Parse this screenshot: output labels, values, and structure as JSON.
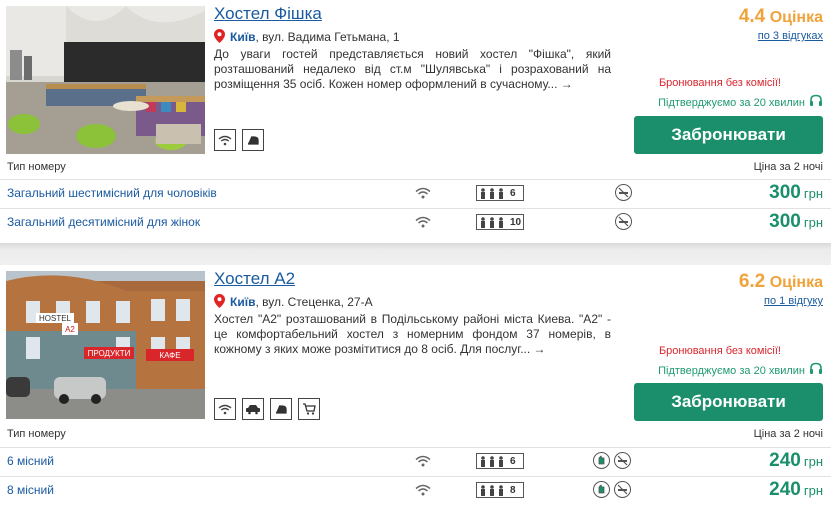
{
  "hostels": [
    {
      "name": "Хостел Фішка",
      "city": "Київ",
      "street": ", вул. Вадима Гетьмана, 1",
      "description": "До уваги гостей представляється новий хостел \"Фішка\", який розташований недалеко від ст.м \"Шулявська\" і розрахований на розміщення 35 осіб. Кожен номер оформлений в сучасному... →",
      "rating": "4.4",
      "rating_label": "Оцінка",
      "reviews": "по 3 відгуках",
      "no_commission": "Бронювання без комісії!",
      "confirm": "Підтверджуємо за 20 хвилин",
      "book_label": "Забронювати",
      "amenities": [
        "wifi-icon",
        "iron-icon"
      ],
      "room_type_header": "Тип номеру",
      "price_header": "Ціна за 2 ночі",
      "rooms": [
        {
          "name": "Загальний шестимісний для чоловіків",
          "capacity": "6",
          "price": "300",
          "currency": "грн"
        },
        {
          "name": "Загальний десятимісний для жінок",
          "capacity": "10",
          "price": "300",
          "currency": "грн"
        }
      ]
    },
    {
      "name": "Хостел А2",
      "city": "Київ",
      "street": ", вул. Стеценка, 27-А",
      "description": "Хостел \"А2\" розташований в Подільському районі міста Киева. \"А2\" - це комфортабельний хостел з номерним фондом 37 номерів, в кожному з яких може розмітитися до 8 осіб. Для послуг... →",
      "rating": "6.2",
      "rating_label": "Оцінка",
      "reviews": "по 1 відгуку",
      "no_commission": "Бронювання без комісії!",
      "confirm": "Підтверджуємо за 20 хвилин",
      "book_label": "Забронювати",
      "amenities": [
        "wifi-icon",
        "parking-icon",
        "iron-icon",
        "shop-cart-icon"
      ],
      "room_type_header": "Тип номеру",
      "price_header": "Ціна за 2 ночі",
      "photo_signs": [
        "HOSTEL",
        "A2",
        "ПРОДУКТИ",
        "КАФЕ"
      ],
      "rooms": [
        {
          "name": "6 місний",
          "capacity": "6",
          "price": "240",
          "currency": "грн"
        },
        {
          "name": "8 місний",
          "capacity": "8",
          "price": "240",
          "currency": "грн"
        }
      ]
    }
  ],
  "colors": {
    "link": "#1a5aa0",
    "rating": "#f0a33a",
    "accent_green": "#1b8f6b",
    "alert_red": "#d9262e"
  }
}
